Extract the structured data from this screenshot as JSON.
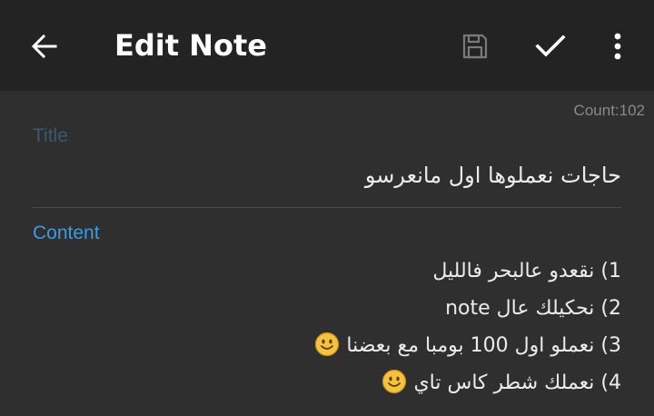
{
  "toolbar": {
    "back_icon": "arrow-back-icon",
    "title": "Edit Note",
    "save_icon": "save-disk-icon",
    "confirm_icon": "check-icon",
    "more_icon": "more-vert-icon",
    "background": "#232323"
  },
  "editor": {
    "count_text": "Count:102",
    "title_label": "Title",
    "title_value": "حاجات نعملوها اول مانعرسو",
    "content_label": "Content",
    "content_lines": [
      {
        "text": "1) نقعدو عالبحر فالليل",
        "emoji": false
      },
      {
        "text": "2) نحكيلك عال note",
        "emoji": false
      },
      {
        "text": "3) نعملو اول 100 بومبا مع بعضنا",
        "emoji": true
      },
      {
        "text": "4) نعملك شطر كاس تاي",
        "emoji": true
      }
    ],
    "emoji_icon": "smiling-face-icon",
    "accent_color": "#3d9be0",
    "background": "#2f2f2f"
  }
}
